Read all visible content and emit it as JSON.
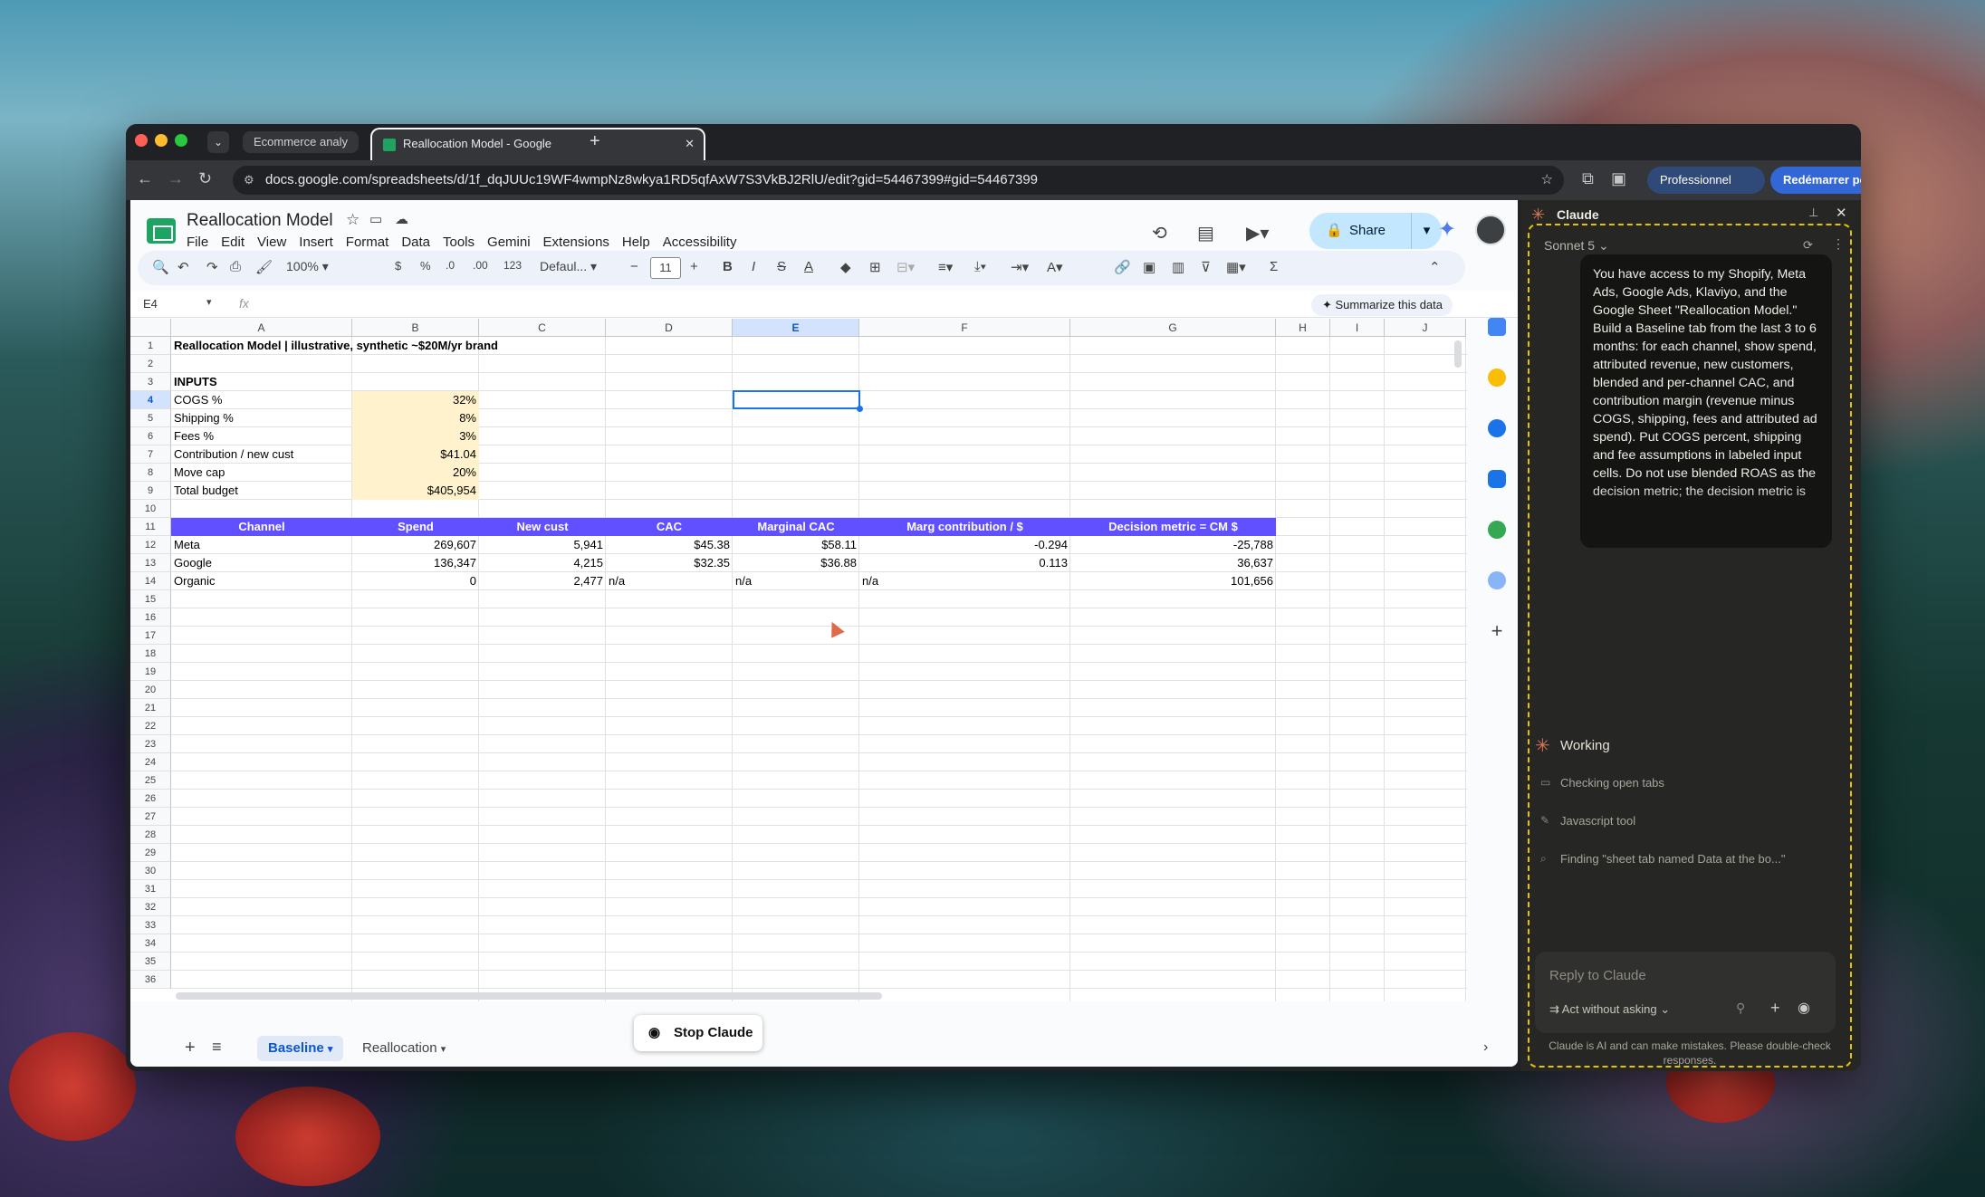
{
  "browser": {
    "tabs": [
      {
        "label": "Ecommerce analy"
      },
      {
        "label": "Reallocation Model - Google"
      }
    ],
    "url": "docs.google.com/spreadsheets/d/1f_dqJUUc19WF4wmpNz8wkya1RD5qfAxW7S3VkBJ2RlU/edit?gid=54467399#gid=54467399",
    "profile": "Professionnel",
    "update": "Redémarrer pour mettre à jour"
  },
  "sheets": {
    "title": "Reallocation Model",
    "menu": [
      "File",
      "Edit",
      "View",
      "Insert",
      "Format",
      "Data",
      "Tools",
      "Gemini",
      "Extensions",
      "Help",
      "Accessibility"
    ],
    "share": "Share",
    "zoom": "100%",
    "font": "Defaul...",
    "font_size": "11",
    "namebox": "E4",
    "fx": "fx",
    "summarize": "Summarize this data",
    "columns": [
      "A",
      "B",
      "C",
      "D",
      "E",
      "F",
      "G",
      "H",
      "I",
      "J"
    ],
    "rows": [
      "1",
      "2",
      "3",
      "4",
      "5",
      "6",
      "7",
      "8",
      "9",
      "10",
      "11",
      "12",
      "13",
      "14",
      "15",
      "16",
      "17",
      "18",
      "19",
      "20",
      "21",
      "22",
      "23",
      "24",
      "25",
      "26",
      "27",
      "28",
      "29",
      "30",
      "31",
      "32",
      "33",
      "34",
      "35",
      "36"
    ],
    "cells": {
      "a1": "Reallocation Model  |  illustrative, synthetic ~$20M/yr brand",
      "a3": "INPUTS",
      "a4": "COGS %",
      "b4": "32%",
      "a5": "Shipping %",
      "b5": "8%",
      "a6": "Fees %",
      "b6": "3%",
      "a7": "Contribution / new cust",
      "b7": "$41.04",
      "a8": "Move cap",
      "b8": "20%",
      "a9": "Total budget",
      "b9": "$405,954",
      "h11": [
        "Channel",
        "Spend",
        "New cust",
        "CAC",
        "Marginal CAC",
        "Marg contribution / $",
        "Decision metric = CM $"
      ],
      "r12": [
        "Meta",
        "269,607",
        "5,941",
        "$45.38",
        "$58.11",
        "-0.294",
        "-25,788"
      ],
      "r13": [
        "Google",
        "136,347",
        "4,215",
        "$32.35",
        "$36.88",
        "0.113",
        "36,637"
      ],
      "r14": [
        "Organic",
        "0",
        "2,477",
        "n/a",
        "n/a",
        "n/a",
        "101,656"
      ]
    },
    "sheet_tabs": [
      {
        "label": "Baseline",
        "active": true
      },
      {
        "label": "Reallocation",
        "active": false
      }
    ],
    "stop": "Stop Claude"
  },
  "claude": {
    "title": "Claude",
    "model": "Sonnet 5",
    "prompt": "You have access to my Shopify, Meta Ads, Google Ads, Klaviyo, and the Google Sheet \"Reallocation Model.\" Build a Baseline tab from the last 3 to 6 months: for each channel, show spend, attributed revenue, new customers, blended and per-channel CAC, and contribution margin (revenue minus COGS, shipping, fees and attributed ad spend). Put COGS percent, shipping and fee assumptions in labeled input cells. Do not use blended ROAS as the decision metric; the decision metric is",
    "status": "Working",
    "steps": [
      "Checking open tabs",
      "Javascript tool",
      "Finding \"sheet tab named Data at the bo...\""
    ],
    "reply_placeholder": "Reply to Claude",
    "mode": "Act without asking",
    "disclaimer": "Claude is AI and can make mistakes. Please double-check responses."
  },
  "colors": {
    "header_purple": "#6050ff",
    "input_yellow": "#fff2cc",
    "selection": "#1a73e8",
    "claude_accent": "#d97757"
  }
}
